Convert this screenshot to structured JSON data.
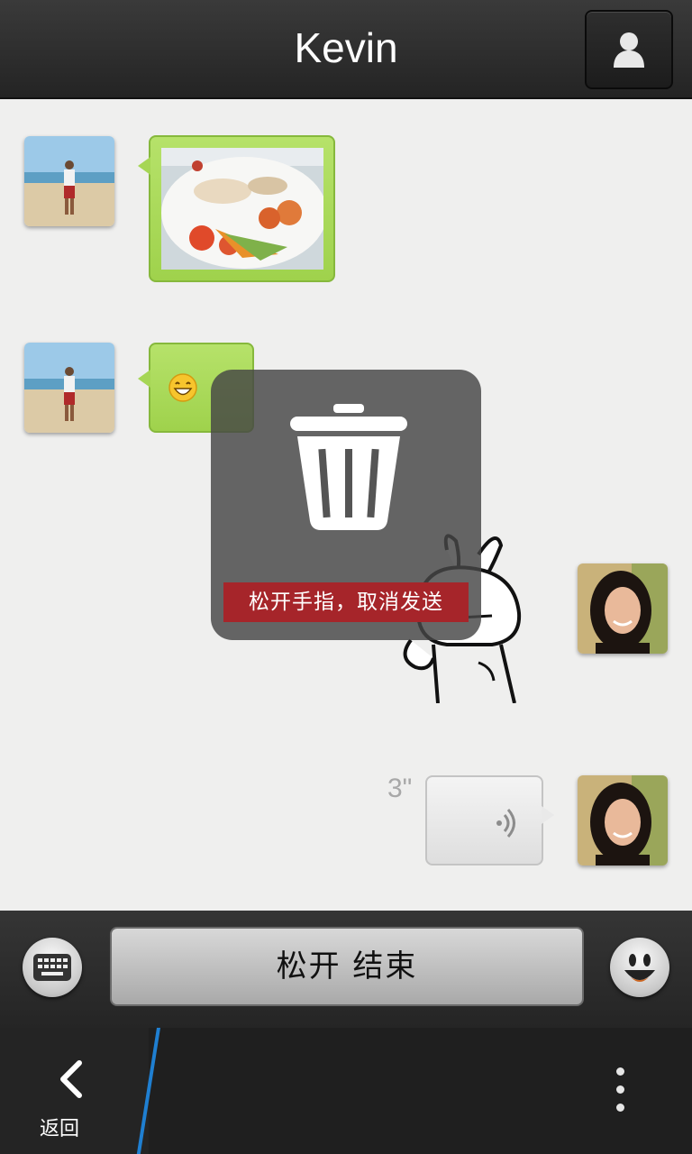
{
  "header": {
    "title": "Kevin",
    "contact_icon": "person-icon"
  },
  "messages": [
    {
      "side": "left",
      "type": "image",
      "content": "grilled squid salad photo"
    },
    {
      "side": "left",
      "type": "emoji",
      "content": "grin-emoji"
    },
    {
      "side": "right",
      "type": "sticker",
      "content": "rabbit-sticker"
    },
    {
      "side": "right",
      "type": "voice",
      "duration": "3\""
    }
  ],
  "overlay": {
    "icon": "trash-icon",
    "hint": "松开手指，取消发送"
  },
  "input_bar": {
    "keyboard_icon": "keyboard-icon",
    "hold_button_label": "松开 结束",
    "emoji_icon": "smiley-icon"
  },
  "nav": {
    "back_label": "返回",
    "back_icon": "chevron-left-icon",
    "more_icon": "more-vertical-icon"
  },
  "colors": {
    "accent_blue": "#1f7fd1",
    "bubble_green": "#a6d655",
    "hint_red": "#a6252a"
  }
}
